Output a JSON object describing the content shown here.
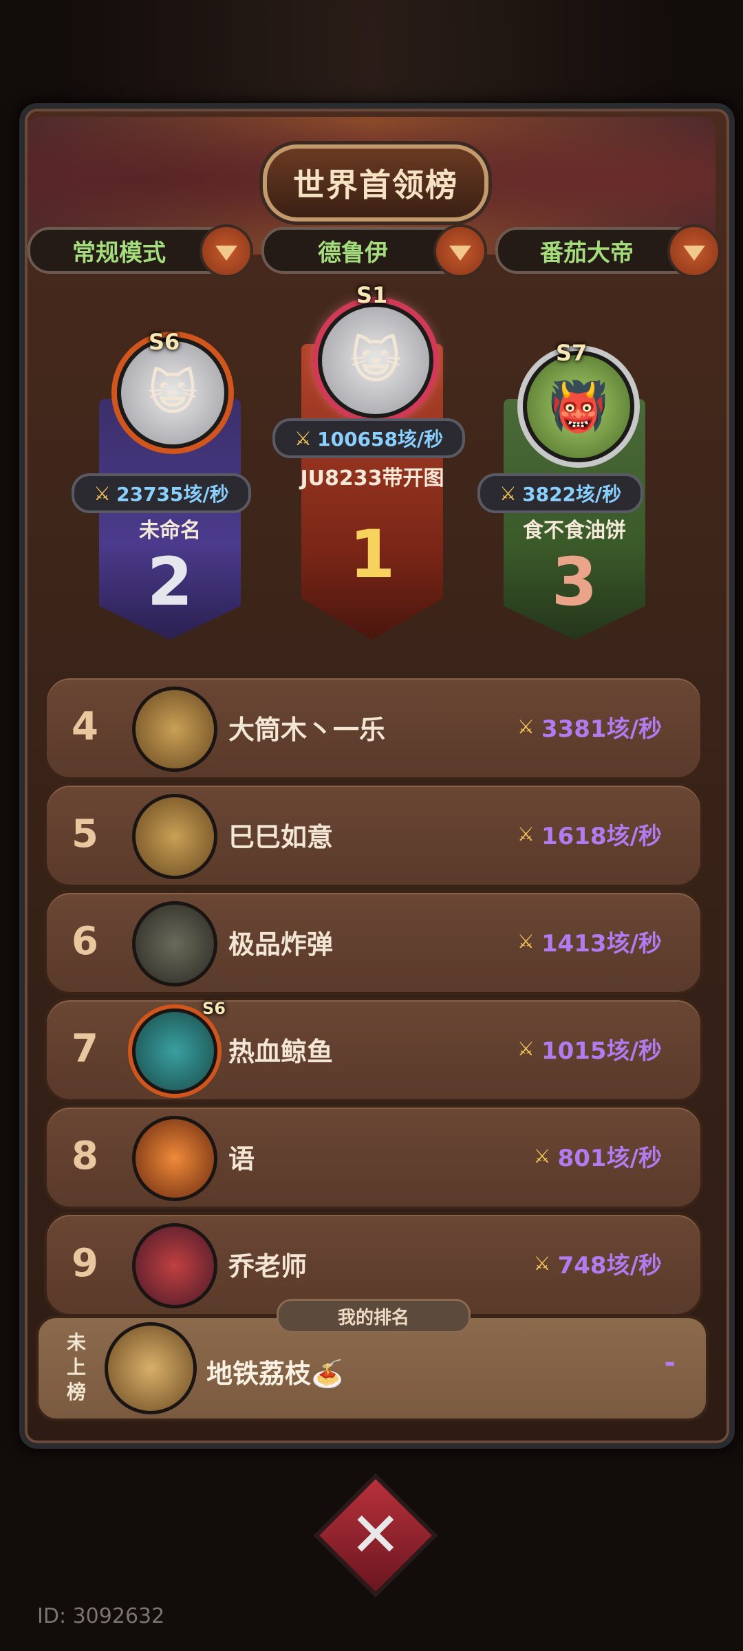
{
  "title": "世界首领榜",
  "filters": [
    {
      "label": "常规模式"
    },
    {
      "label": "德鲁伊"
    },
    {
      "label": "番茄大帝"
    }
  ],
  "podium": {
    "first": {
      "rank": "1",
      "season": "S1",
      "score": "100658垓/秒",
      "name": "JU8233带开图"
    },
    "second": {
      "rank": "2",
      "season": "S6",
      "score": "23735垓/秒",
      "name": "未命名"
    },
    "third": {
      "rank": "3",
      "season": "S7",
      "score": "3822垓/秒",
      "name": "食不食油饼"
    }
  },
  "rows": [
    {
      "rank": "4",
      "name": "大筒木丶一乐",
      "score": "3381垓/秒"
    },
    {
      "rank": "5",
      "name": "巳巳如意",
      "score": "1618垓/秒"
    },
    {
      "rank": "6",
      "name": "极品炸弹",
      "score": "1413垓/秒"
    },
    {
      "rank": "7",
      "name": "热血鲸鱼",
      "score": "1015垓/秒",
      "season": "S6"
    },
    {
      "rank": "8",
      "name": "语",
      "score": "801垓/秒"
    },
    {
      "rank": "9",
      "name": "乔老师",
      "score": "748垓/秒"
    }
  ],
  "my_rank": {
    "tab_label": "我的排名",
    "status": "未上榜",
    "name": "地铁荔枝🍝",
    "value": "-"
  },
  "footer": {
    "id": "ID: 3092632"
  },
  "colors": {
    "score_purple": "#b07cf0",
    "filter_green": "#a5dd7d",
    "accent_red": "#b8313a"
  }
}
